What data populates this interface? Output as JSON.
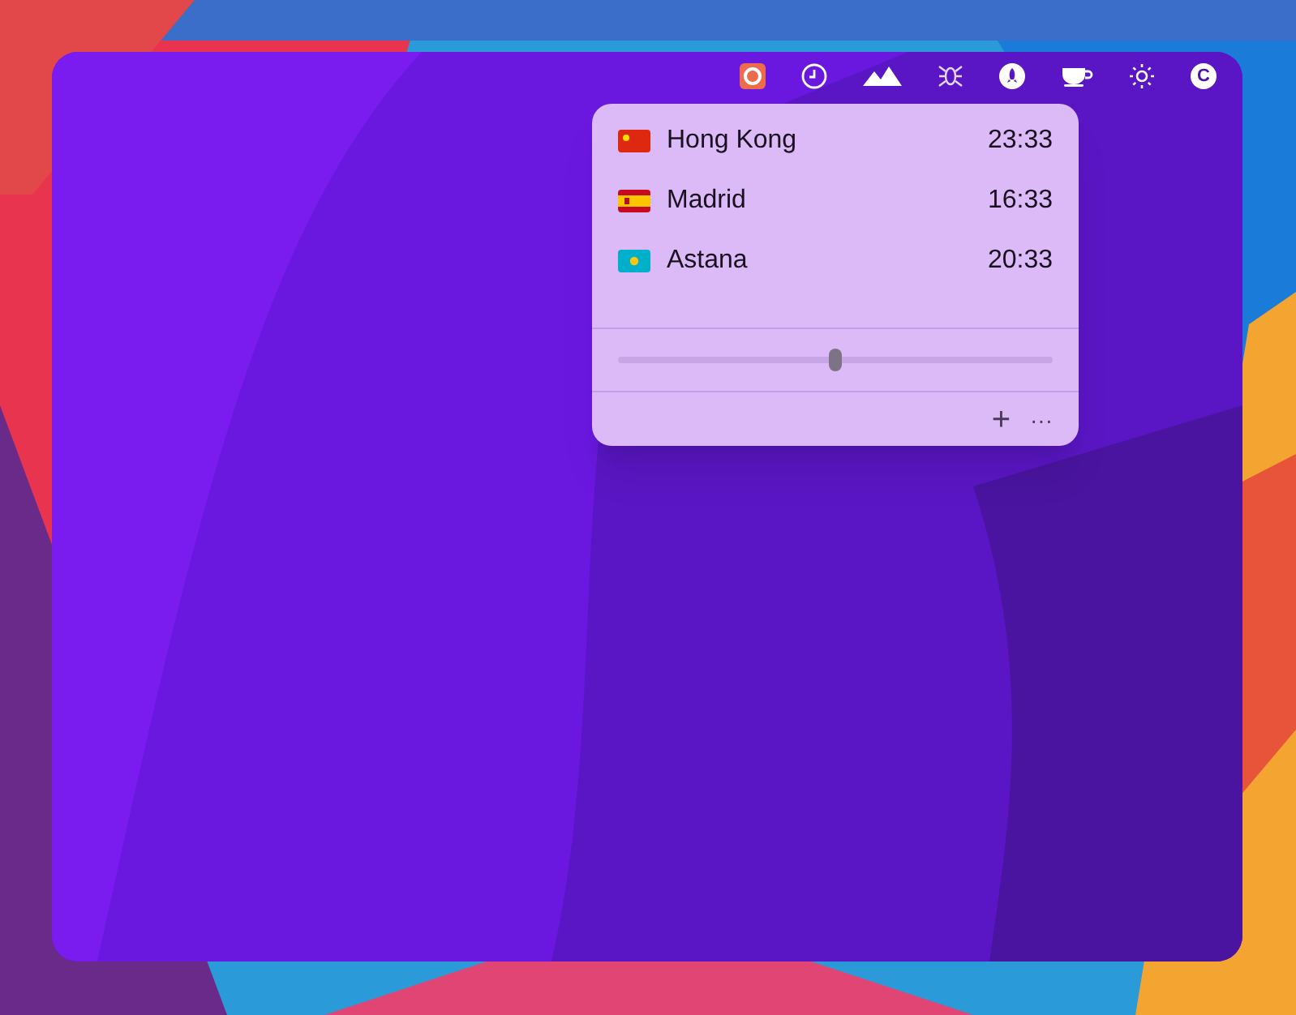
{
  "menu_bar": {
    "items": [
      {
        "kind": "app"
      },
      {
        "kind": "clock"
      },
      {
        "kind": "mountains"
      },
      {
        "kind": "spider"
      },
      {
        "kind": "rocket"
      },
      {
        "kind": "cup"
      },
      {
        "kind": "sun"
      },
      {
        "kind": "letter",
        "label": "C"
      }
    ]
  },
  "world_clock": {
    "cities": [
      {
        "kind": "china",
        "name": "Hong Kong",
        "time": "23:33"
      },
      {
        "kind": "spain",
        "name": "Madrid",
        "time": "16:33"
      },
      {
        "kind": "kazakhstan",
        "name": "Astana",
        "time": "20:33"
      }
    ],
    "slider": {
      "level": 0.5
    },
    "footer": {
      "add": "+",
      "more": "···"
    }
  }
}
